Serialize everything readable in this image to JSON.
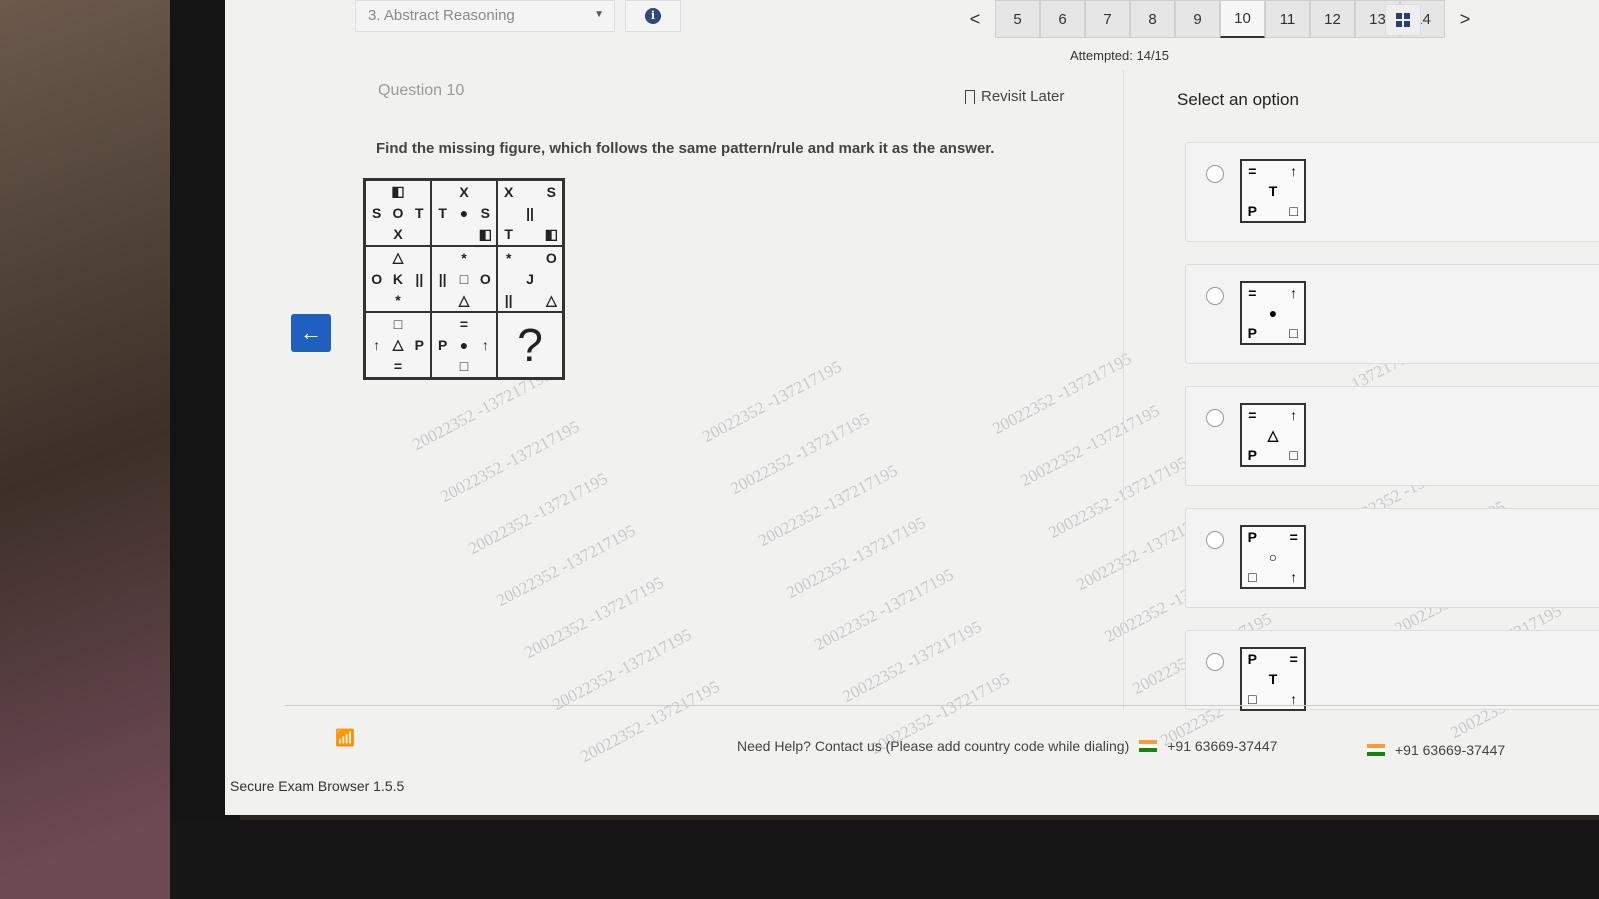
{
  "header": {
    "section": "3. Abstract Reasoning",
    "info_icon": "i",
    "nav_prev": "<",
    "nav_next": ">",
    "questions": [
      "5",
      "6",
      "7",
      "8",
      "9",
      "10",
      "11",
      "12",
      "13",
      "14"
    ],
    "active_question": "10",
    "attempted": "Attempted: 14/15"
  },
  "question": {
    "label": "Question 10",
    "revisit": "Revisit Later",
    "instruction": "Find the missing figure, which follows the same pattern/rule and mark it as the answer.",
    "cells": [
      [
        "",
        "◧",
        "",
        "S",
        "O",
        "T",
        "",
        "X",
        ""
      ],
      [
        "",
        "X",
        "",
        "T",
        "●",
        "S",
        "",
        "",
        "◧"
      ],
      [
        "X",
        "",
        "S",
        "",
        "||",
        "",
        "T",
        "",
        "◧"
      ],
      [
        "",
        "△",
        "",
        "O",
        "K",
        "||",
        "",
        "*",
        ""
      ],
      [
        "",
        "*",
        "",
        "||",
        "□",
        "O",
        "",
        "△",
        ""
      ],
      [
        "*",
        "",
        "O",
        "",
        "J",
        "",
        "||",
        "",
        "△"
      ],
      [
        "",
        "□",
        "",
        "↑",
        "△",
        "P",
        "",
        "=",
        ""
      ],
      [
        "",
        "=",
        "",
        "P",
        "●",
        "↑",
        "",
        "□",
        ""
      ]
    ],
    "missing": "?"
  },
  "options": {
    "title": "Select an option",
    "items": [
      [
        "=",
        "",
        "↑",
        "",
        "T",
        "",
        "P",
        "",
        "□"
      ],
      [
        "=",
        "",
        "↑",
        "",
        "●",
        "",
        "P",
        "",
        "□"
      ],
      [
        "=",
        "",
        "↑",
        "",
        "△",
        "",
        "P",
        "",
        "□"
      ],
      [
        "P",
        "",
        "=",
        "",
        "○",
        "",
        "□",
        "",
        "↑"
      ],
      [
        "P",
        "",
        "=",
        "",
        "T",
        "",
        "□",
        "",
        "↑"
      ]
    ]
  },
  "footer": {
    "help": "Need Help? Contact us (Please add country code while dialing)",
    "phone": "+91 63669-37447",
    "phone2": "+91 63669-37447",
    "browser": "Secure Exam Browser 1.5.5"
  },
  "watermark": "20022352 -137217195",
  "colors": {
    "accent": "#1f5fbf",
    "icon": "#2c3e6a"
  }
}
